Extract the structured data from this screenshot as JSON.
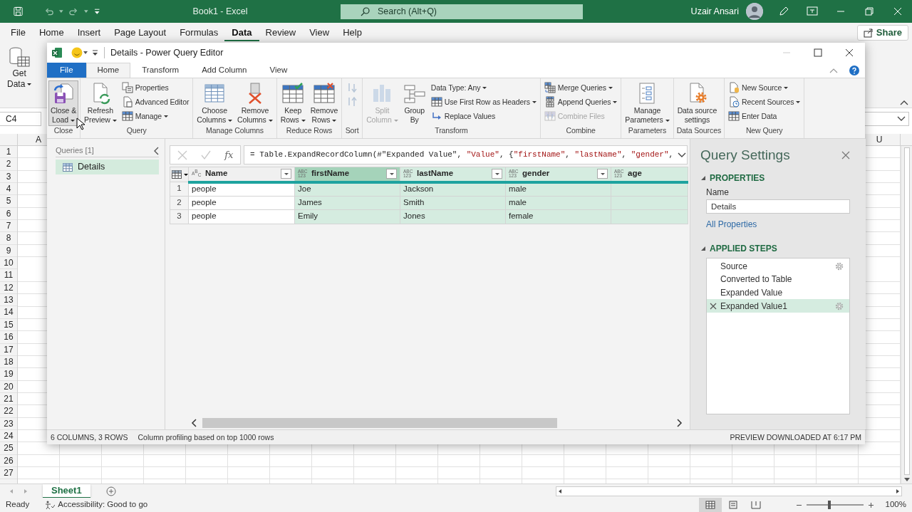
{
  "excel": {
    "title": "Book1  -  Excel",
    "search": {
      "placeholder": "Search (Alt+Q)"
    },
    "user": "Uzair Ansari",
    "menu": [
      {
        "label": "File",
        "selected": false
      },
      {
        "label": "Home",
        "selected": false
      },
      {
        "label": "Insert",
        "selected": false
      },
      {
        "label": "Page Layout",
        "selected": false
      },
      {
        "label": "Formulas",
        "selected": false
      },
      {
        "label": "Data",
        "selected": true
      },
      {
        "label": "Review",
        "selected": false
      },
      {
        "label": "View",
        "selected": false
      },
      {
        "label": "Help",
        "selected": false
      }
    ],
    "share": "Share",
    "get_data": {
      "label": "Get\nData",
      "dropdown": true
    },
    "name_box": "C4",
    "column_headers": [
      "A",
      "U"
    ],
    "row_headers": [
      "1",
      "2",
      "3",
      "4",
      "5",
      "6",
      "7",
      "8",
      "9",
      "10",
      "11",
      "12",
      "13",
      "14",
      "15",
      "16",
      "17",
      "18",
      "19",
      "20",
      "21",
      "22",
      "23",
      "24",
      "25",
      "26",
      "27"
    ],
    "sheets": [
      {
        "label": "Sheet1",
        "selected": true
      }
    ],
    "status_bar": {
      "ready": "Ready",
      "accessibility": "Accessibility: Good to go",
      "zoom": {
        "level": 0.4,
        "reading": "100%"
      }
    }
  },
  "editor": {
    "title": "Details - Power Query Editor",
    "tabs": [
      {
        "label": "File",
        "kind": "backstage",
        "selected": false
      },
      {
        "label": "Home",
        "kind": "tab",
        "selected": true
      },
      {
        "label": "Transform",
        "kind": "tab",
        "selected": false
      },
      {
        "label": "Add Column",
        "kind": "tab",
        "selected": false
      },
      {
        "label": "View",
        "kind": "tab",
        "selected": false
      }
    ],
    "ribbon_groups": [
      {
        "label": "Close",
        "items": [
          {
            "kind": "large",
            "label": "Close &\nLoad",
            "dropdown": true,
            "disabled": false,
            "hovered": true
          }
        ]
      },
      {
        "label": "Query",
        "items": [
          {
            "kind": "large",
            "label": "Refresh\nPreview",
            "dropdown": true,
            "disabled": false,
            "hovered": false
          },
          {
            "kind": "small",
            "label": "Properties",
            "dropdown": false,
            "disabled": false,
            "hovered": false
          },
          {
            "kind": "small",
            "label": "Advanced Editor",
            "dropdown": false,
            "disabled": false,
            "hovered": false
          },
          {
            "kind": "small",
            "label": "Manage",
            "dropdown": true,
            "disabled": false,
            "hovered": false
          }
        ]
      },
      {
        "label": "Manage Columns",
        "items": [
          {
            "kind": "large",
            "label": "Choose\nColumns",
            "dropdown": true,
            "disabled": false,
            "hovered": false
          },
          {
            "kind": "large",
            "label": "Remove\nColumns",
            "dropdown": true,
            "disabled": false,
            "hovered": false
          }
        ]
      },
      {
        "label": "Reduce Rows",
        "items": [
          {
            "kind": "large",
            "label": "Keep\nRows",
            "dropdown": true,
            "disabled": false,
            "hovered": false
          },
          {
            "kind": "large",
            "label": "Remove\nRows",
            "dropdown": true,
            "disabled": false,
            "hovered": false
          }
        ]
      },
      {
        "label": "Sort",
        "items": [
          {
            "kind": "icon",
            "disabled": true,
            "hovered": false
          },
          {
            "kind": "icon",
            "disabled": true,
            "hovered": false
          }
        ]
      },
      {
        "label": "Transform",
        "items": [
          {
            "kind": "large",
            "label": "Split\nColumn",
            "dropdown": true,
            "disabled": true,
            "hovered": false
          },
          {
            "kind": "large",
            "label": "Group\nBy",
            "dropdown": false,
            "disabled": false,
            "hovered": false
          },
          {
            "kind": "small",
            "label": "Data Type: Any",
            "dropdown": true,
            "disabled": false,
            "hovered": false
          },
          {
            "kind": "small",
            "label": "Use First Row as Headers",
            "dropdown": true,
            "disabled": false,
            "hovered": false
          },
          {
            "kind": "small",
            "label": "Replace Values",
            "dropdown": false,
            "disabled": false,
            "hovered": false
          }
        ]
      },
      {
        "label": "Combine",
        "items": [
          {
            "kind": "small",
            "label": "Merge Queries",
            "dropdown": true,
            "disabled": false,
            "hovered": false
          },
          {
            "kind": "small",
            "label": "Append Queries",
            "dropdown": true,
            "disabled": false,
            "hovered": false
          },
          {
            "kind": "small",
            "label": "Combine Files",
            "dropdown": false,
            "disabled": true,
            "hovered": false
          }
        ]
      },
      {
        "label": "Parameters",
        "items": [
          {
            "kind": "large",
            "label": "Manage\nParameters",
            "dropdown": true,
            "disabled": false,
            "hovered": false
          }
        ]
      },
      {
        "label": "Data Sources",
        "items": [
          {
            "kind": "large",
            "label": "Data source\nsettings",
            "dropdown": false,
            "disabled": false,
            "hovered": false
          }
        ]
      },
      {
        "label": "New Query",
        "items": [
          {
            "kind": "small",
            "label": "New Source",
            "dropdown": true,
            "disabled": false,
            "hovered": false
          },
          {
            "kind": "small",
            "label": "Recent Sources",
            "dropdown": true,
            "disabled": false,
            "hovered": false
          },
          {
            "kind": "small",
            "label": "Enter Data",
            "dropdown": false,
            "disabled": false,
            "hovered": false
          }
        ]
      }
    ],
    "queries": {
      "header": "Queries [1]",
      "items": [
        {
          "label": "Details",
          "selected": true
        }
      ]
    },
    "formula_bar": {
      "fx": "fx",
      "tokens": [
        {
          "kind": "code",
          "text": "= Table.ExpandRecordColumn(#\"Expanded Value\", "
        },
        {
          "kind": "string",
          "text": "\"Value\""
        },
        {
          "kind": "code",
          "text": ", {"
        },
        {
          "kind": "string",
          "text": "\"firstName\""
        },
        {
          "kind": "code",
          "text": ", "
        },
        {
          "kind": "string",
          "text": "\"lastName\""
        },
        {
          "kind": "code",
          "text": ", "
        },
        {
          "kind": "string",
          "text": "\"gender\""
        },
        {
          "kind": "code",
          "text": ","
        }
      ]
    },
    "table": {
      "columns": [
        {
          "name": "Name",
          "type": "A$^{B}$$_{C}$",
          "selected": false,
          "highlighted": false,
          "filter_button": true
        },
        {
          "name": "firstName",
          "type": "ABC\n123",
          "selected": true,
          "highlighted": true,
          "filter_button": true
        },
        {
          "name": "lastName",
          "type": "ABC\n123",
          "selected": false,
          "highlighted": true,
          "filter_button": true
        },
        {
          "name": "gender",
          "type": "ABC\n123",
          "selected": false,
          "highlighted": true,
          "filter_button": true
        },
        {
          "name": "age",
          "type": "ABC\n123",
          "selected": false,
          "highlighted": true,
          "filter_button": false
        }
      ],
      "rows": [
        {
          "number": "1",
          "cells": [
            "people",
            "Joe",
            "Jackson",
            "male"
          ]
        },
        {
          "number": "2",
          "cells": [
            "people",
            "James",
            "Smith",
            "male"
          ]
        },
        {
          "number": "3",
          "cells": [
            "people",
            "Emily",
            "Jones",
            "female"
          ]
        }
      ]
    },
    "settings": {
      "title": "Query Settings",
      "properties_heading": "PROPERTIES",
      "name_label": "Name",
      "name_value": "Details",
      "all_properties": "All Properties",
      "steps_heading": "APPLIED STEPS",
      "steps": [
        {
          "label": "Source",
          "selected": false,
          "settings": true
        },
        {
          "label": "Converted to Table",
          "selected": false,
          "settings": false
        },
        {
          "label": "Expanded Value",
          "selected": false,
          "settings": false
        },
        {
          "label": "Expanded Value1",
          "selected": true,
          "settings": true
        }
      ]
    },
    "status_bar": {
      "summary": "6 COLUMNS, 3 ROWS",
      "profiling": "Column profiling based on top 1000 rows",
      "preview": "PREVIEW DOWNLOADED AT 6:17 PM"
    }
  }
}
